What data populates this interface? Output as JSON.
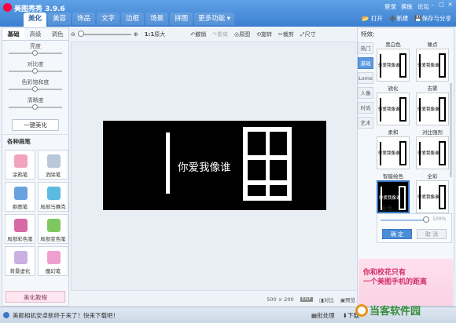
{
  "app": {
    "title": "美图秀秀 3.9.6"
  },
  "tabs": [
    "美化",
    "美容",
    "饰品",
    "文字",
    "边框",
    "场景",
    "拼图",
    "更多功能"
  ],
  "active_tab": "美化",
  "top_links": {
    "login": "登录",
    "skin": "换肤",
    "forum": "论坛"
  },
  "top_actions": {
    "open": "打开",
    "new": "新建",
    "save_share": "保存与分享"
  },
  "toolbar": {
    "zoom_11": "1:1",
    "original": "原大",
    "undo": "撤销",
    "redo": "重做",
    "compare": "原图",
    "rotate": "旋转",
    "crop": "裁剪",
    "resize": "尺寸"
  },
  "left": {
    "subtabs": [
      "基础",
      "高级",
      "调色"
    ],
    "sliders": [
      {
        "label": "亮度",
        "value": 0.5
      },
      {
        "label": "对比度",
        "value": 0.5
      },
      {
        "label": "色彩饱和度",
        "value": 0.5
      },
      {
        "label": "清晰度",
        "value": 0.5
      }
    ],
    "onekey": "一键美化",
    "brushes_head": "各种画笔",
    "brushes": [
      "涂鸦笔",
      "消除笔",
      "抠图笔",
      "局部马赛克",
      "局部彩色笔",
      "局部变色笔",
      "背景虚化",
      "魔幻笔"
    ],
    "tutorial": "美化教程"
  },
  "canvas": {
    "text": "你爱我像谁",
    "size": "500 × 200",
    "exif": "EXIF",
    "compare": "对比",
    "preview": "预览"
  },
  "right": {
    "head": "特效:",
    "tabs": [
      "热门",
      "基础",
      "Lomo",
      "人像",
      "时尚",
      "艺术"
    ],
    "effects": [
      "黑白色",
      "噪点",
      "锐化",
      "去雾",
      "柔和",
      "对比强烈",
      "智能绘色",
      "全彩"
    ],
    "thumb_text": "你爱我像谁",
    "reverse": "反色",
    "opacity": 1.0,
    "opacity_label": "100%",
    "ok": "确 定",
    "cancel": "取 消",
    "ad_line1": "你和校花只有",
    "ad_line2": "一个美图手机的距离"
  },
  "bottom": {
    "notice": "美颜相机安卓新终于来了！快来下载吧！",
    "batch": "批处理",
    "download": "下载"
  },
  "watermark": "当客软件园"
}
